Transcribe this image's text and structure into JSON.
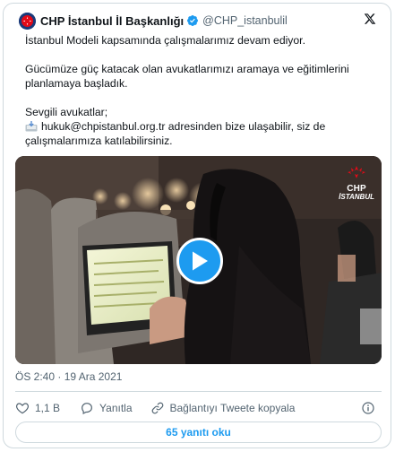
{
  "tweet": {
    "author_name": "CHP İstanbul İl Başkanlığı",
    "author_handle": "@CHP_istanbulil",
    "verified": true,
    "paragraph1": "İstanbul Modeli kapsamında çalışmalarımız devam ediyor.",
    "paragraph2_line1": "Gücümüze güç katacak olan avukatlarımızı aramaya ve eğitimlerini",
    "paragraph2_line2": "planlamaya başladık.",
    "paragraph3_line1": "Sevgili avukatlar;",
    "paragraph3_line2": "hukuk@chpistanbul.org.tr adresinden bize ulaşabilir, siz de",
    "paragraph3_line3": "çalışmalarımıza katılabilirsiniz.",
    "timestamp": "ÖS 2:40 · 19 Ara 2021"
  },
  "media": {
    "type": "video",
    "brand_mark": "CHP",
    "brand_sub": "İSTANBUL"
  },
  "actions": {
    "like_count": "1,1 B",
    "reply_label": "Yanıtla",
    "copy_link_label": "Bağlantıyı Tweete kopyala"
  },
  "footer": {
    "read_replies_label": "65 yanıtı oku"
  },
  "icons": {
    "like": "heart-icon",
    "reply": "speech-bubble-icon",
    "copy_link": "link-icon",
    "info": "info-icon",
    "logo": "x-logo-icon",
    "verified": "verified-badge-icon",
    "play": "play-icon"
  },
  "colors": {
    "accent": "#1d9bf0",
    "text": "#0f1419",
    "muted": "#536471",
    "border": "#cfd9de"
  }
}
